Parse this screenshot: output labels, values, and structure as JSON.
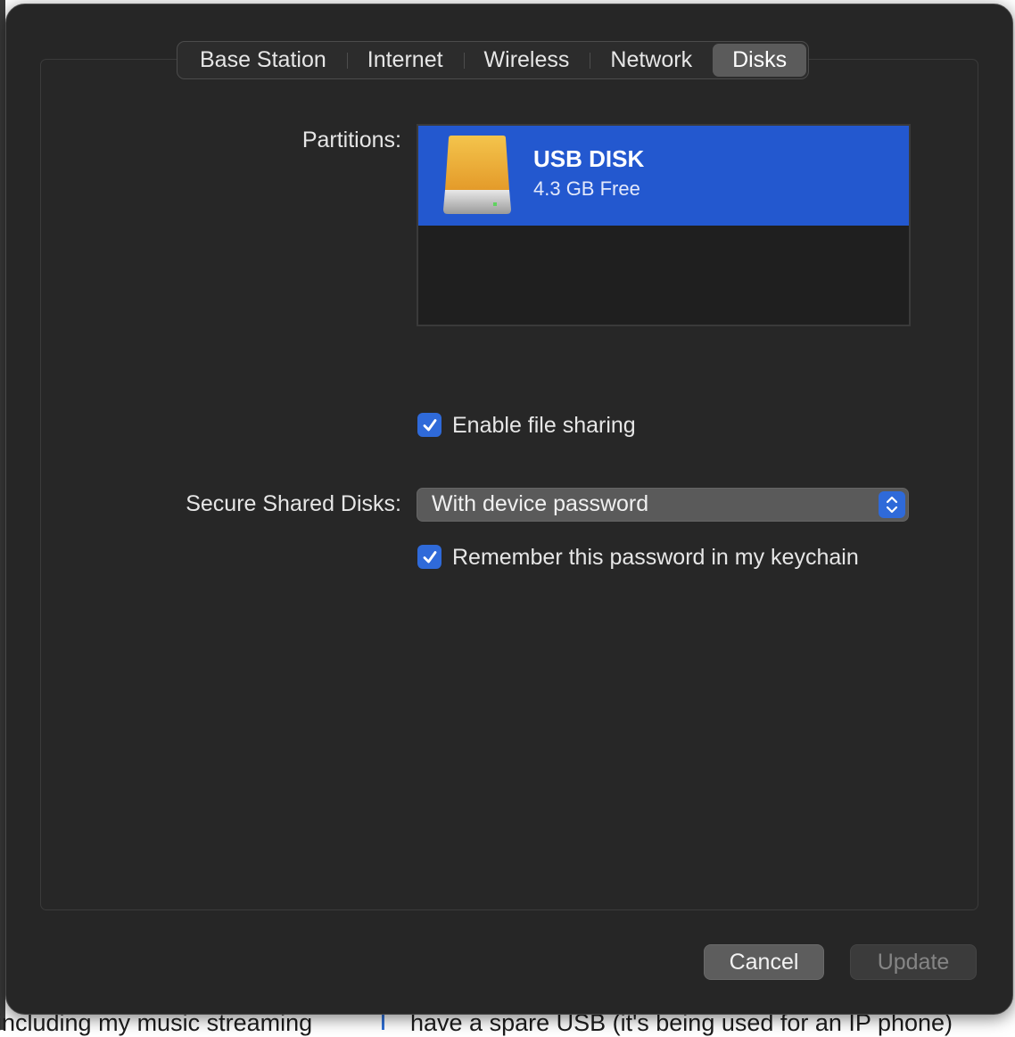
{
  "tabs": [
    {
      "label": "Base Station",
      "selected": false
    },
    {
      "label": "Internet",
      "selected": false
    },
    {
      "label": "Wireless",
      "selected": false
    },
    {
      "label": "Network",
      "selected": false
    },
    {
      "label": "Disks",
      "selected": true
    }
  ],
  "partitions": {
    "label": "Partitions:",
    "items": [
      {
        "name": "USB DISK",
        "free": "4.3 GB Free",
        "icon": "external-drive-icon",
        "selected": true
      }
    ]
  },
  "file_sharing": {
    "label": "Enable file sharing",
    "checked": true
  },
  "secure_shared_disks": {
    "label": "Secure Shared Disks:",
    "value": "With device password"
  },
  "remember_password": {
    "label": "Remember this password in my keychain",
    "checked": true
  },
  "buttons": {
    "cancel": "Cancel",
    "update": "Update"
  },
  "background": {
    "left_text": "including my music streaming",
    "right_text": "have a spare USB (it's being used for an IP phone)"
  },
  "colors": {
    "accent": "#2f6ad9",
    "selection": "#2358cf",
    "sheet_bg": "#262626"
  }
}
